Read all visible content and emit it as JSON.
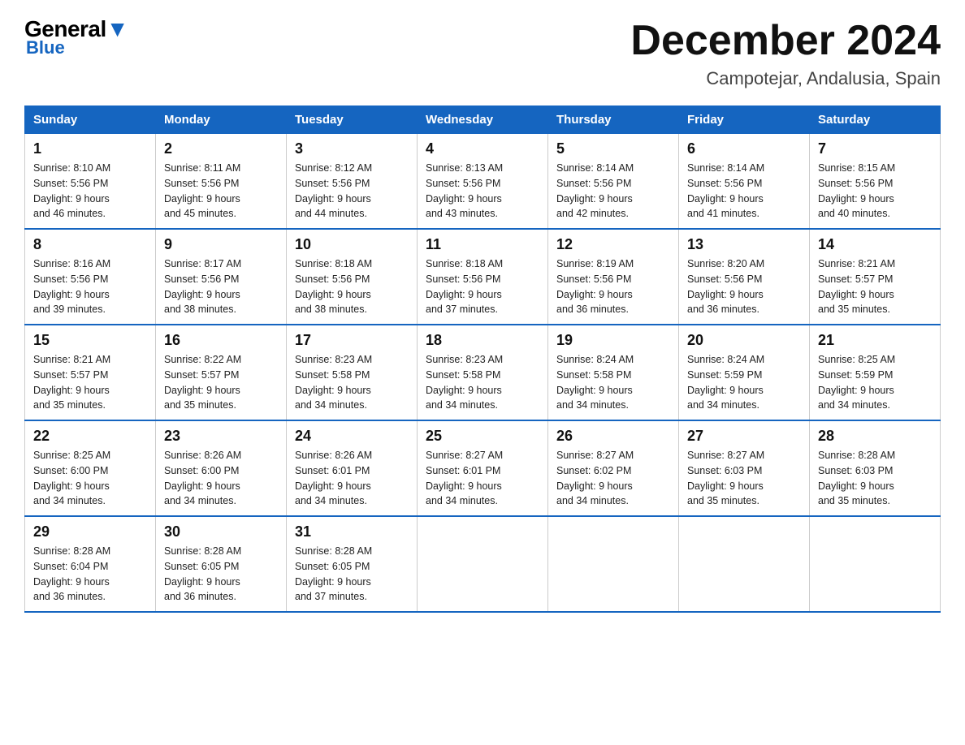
{
  "header": {
    "logo_general": "General",
    "logo_blue": "Blue",
    "month_title": "December 2024",
    "location": "Campotejar, Andalusia, Spain"
  },
  "weekdays": [
    "Sunday",
    "Monday",
    "Tuesday",
    "Wednesday",
    "Thursday",
    "Friday",
    "Saturday"
  ],
  "weeks": [
    [
      {
        "num": "1",
        "sunrise": "8:10 AM",
        "sunset": "5:56 PM",
        "daylight": "9 hours and 46 minutes."
      },
      {
        "num": "2",
        "sunrise": "8:11 AM",
        "sunset": "5:56 PM",
        "daylight": "9 hours and 45 minutes."
      },
      {
        "num": "3",
        "sunrise": "8:12 AM",
        "sunset": "5:56 PM",
        "daylight": "9 hours and 44 minutes."
      },
      {
        "num": "4",
        "sunrise": "8:13 AM",
        "sunset": "5:56 PM",
        "daylight": "9 hours and 43 minutes."
      },
      {
        "num": "5",
        "sunrise": "8:14 AM",
        "sunset": "5:56 PM",
        "daylight": "9 hours and 42 minutes."
      },
      {
        "num": "6",
        "sunrise": "8:14 AM",
        "sunset": "5:56 PM",
        "daylight": "9 hours and 41 minutes."
      },
      {
        "num": "7",
        "sunrise": "8:15 AM",
        "sunset": "5:56 PM",
        "daylight": "9 hours and 40 minutes."
      }
    ],
    [
      {
        "num": "8",
        "sunrise": "8:16 AM",
        "sunset": "5:56 PM",
        "daylight": "9 hours and 39 minutes."
      },
      {
        "num": "9",
        "sunrise": "8:17 AM",
        "sunset": "5:56 PM",
        "daylight": "9 hours and 38 minutes."
      },
      {
        "num": "10",
        "sunrise": "8:18 AM",
        "sunset": "5:56 PM",
        "daylight": "9 hours and 38 minutes."
      },
      {
        "num": "11",
        "sunrise": "8:18 AM",
        "sunset": "5:56 PM",
        "daylight": "9 hours and 37 minutes."
      },
      {
        "num": "12",
        "sunrise": "8:19 AM",
        "sunset": "5:56 PM",
        "daylight": "9 hours and 36 minutes."
      },
      {
        "num": "13",
        "sunrise": "8:20 AM",
        "sunset": "5:56 PM",
        "daylight": "9 hours and 36 minutes."
      },
      {
        "num": "14",
        "sunrise": "8:21 AM",
        "sunset": "5:57 PM",
        "daylight": "9 hours and 35 minutes."
      }
    ],
    [
      {
        "num": "15",
        "sunrise": "8:21 AM",
        "sunset": "5:57 PM",
        "daylight": "9 hours and 35 minutes."
      },
      {
        "num": "16",
        "sunrise": "8:22 AM",
        "sunset": "5:57 PM",
        "daylight": "9 hours and 35 minutes."
      },
      {
        "num": "17",
        "sunrise": "8:23 AM",
        "sunset": "5:58 PM",
        "daylight": "9 hours and 34 minutes."
      },
      {
        "num": "18",
        "sunrise": "8:23 AM",
        "sunset": "5:58 PM",
        "daylight": "9 hours and 34 minutes."
      },
      {
        "num": "19",
        "sunrise": "8:24 AM",
        "sunset": "5:58 PM",
        "daylight": "9 hours and 34 minutes."
      },
      {
        "num": "20",
        "sunrise": "8:24 AM",
        "sunset": "5:59 PM",
        "daylight": "9 hours and 34 minutes."
      },
      {
        "num": "21",
        "sunrise": "8:25 AM",
        "sunset": "5:59 PM",
        "daylight": "9 hours and 34 minutes."
      }
    ],
    [
      {
        "num": "22",
        "sunrise": "8:25 AM",
        "sunset": "6:00 PM",
        "daylight": "9 hours and 34 minutes."
      },
      {
        "num": "23",
        "sunrise": "8:26 AM",
        "sunset": "6:00 PM",
        "daylight": "9 hours and 34 minutes."
      },
      {
        "num": "24",
        "sunrise": "8:26 AM",
        "sunset": "6:01 PM",
        "daylight": "9 hours and 34 minutes."
      },
      {
        "num": "25",
        "sunrise": "8:27 AM",
        "sunset": "6:01 PM",
        "daylight": "9 hours and 34 minutes."
      },
      {
        "num": "26",
        "sunrise": "8:27 AM",
        "sunset": "6:02 PM",
        "daylight": "9 hours and 34 minutes."
      },
      {
        "num": "27",
        "sunrise": "8:27 AM",
        "sunset": "6:03 PM",
        "daylight": "9 hours and 35 minutes."
      },
      {
        "num": "28",
        "sunrise": "8:28 AM",
        "sunset": "6:03 PM",
        "daylight": "9 hours and 35 minutes."
      }
    ],
    [
      {
        "num": "29",
        "sunrise": "8:28 AM",
        "sunset": "6:04 PM",
        "daylight": "9 hours and 36 minutes."
      },
      {
        "num": "30",
        "sunrise": "8:28 AM",
        "sunset": "6:05 PM",
        "daylight": "9 hours and 36 minutes."
      },
      {
        "num": "31",
        "sunrise": "8:28 AM",
        "sunset": "6:05 PM",
        "daylight": "9 hours and 37 minutes."
      },
      null,
      null,
      null,
      null
    ]
  ],
  "labels": {
    "sunrise": "Sunrise:",
    "sunset": "Sunset:",
    "daylight": "Daylight:"
  }
}
